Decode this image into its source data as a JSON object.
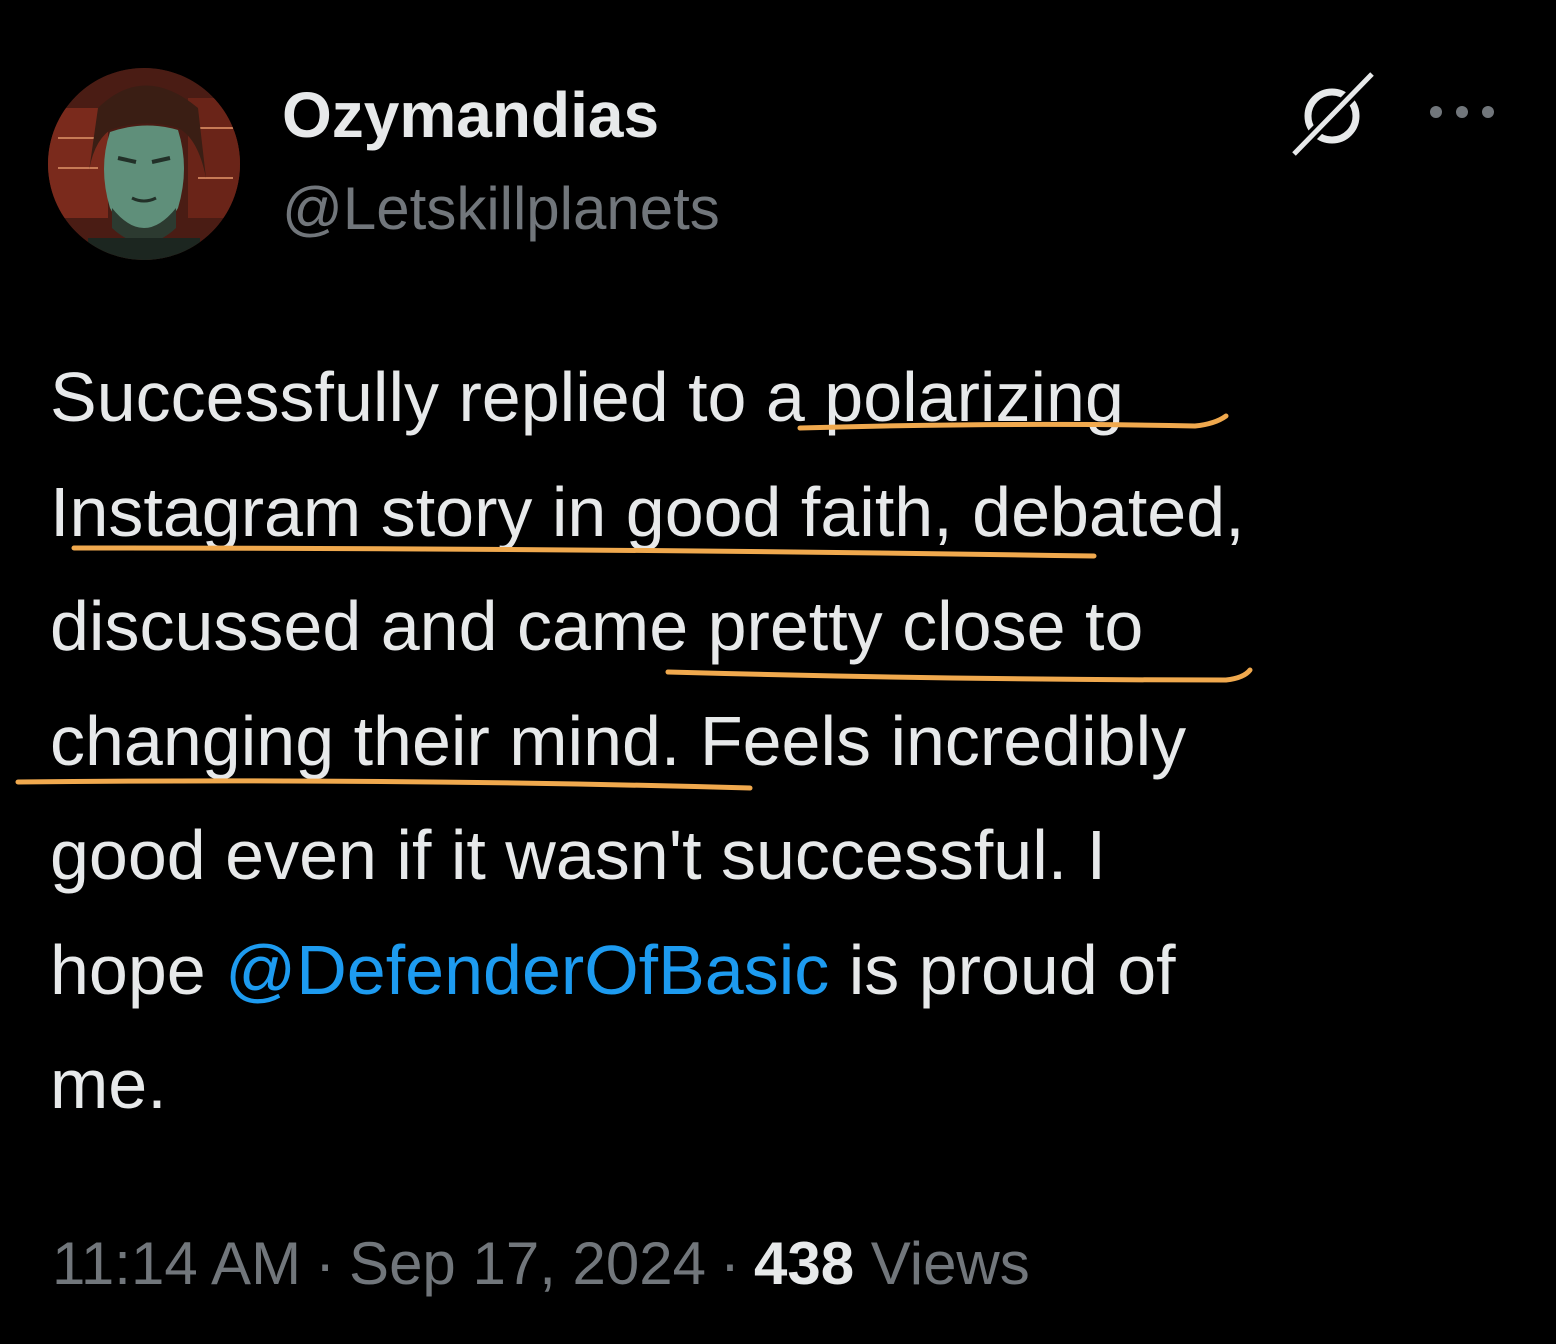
{
  "tweet": {
    "author": {
      "display_name": "Ozymandias",
      "handle": "@Letskillplanets",
      "avatar": "comic-portrait-avatar"
    },
    "header_icons": [
      "grok-icon",
      "more-horizontal-icon"
    ],
    "text_lines": {
      "l1": "Successfully replied to a polarizing",
      "l2": "Instagram story in good faith, debated,",
      "l3": "discussed and came pretty close to",
      "l4": "changing their mind. Feels incredibly",
      "l5": "good even if it wasn't successful. I",
      "l6_before": "hope ",
      "l6_mention": "@DefenderOfBasic",
      "l6_after": " is proud of",
      "l7": "me."
    },
    "time": "11:14 AM",
    "date": "Sep 17, 2024",
    "separator": "·",
    "views_count": "438",
    "views_label": "Views"
  },
  "colors": {
    "background": "#000000",
    "text": "#e7e9ea",
    "secondary": "#71767b",
    "link": "#1d9bf0",
    "underline_annotation": "#f0a94e"
  }
}
